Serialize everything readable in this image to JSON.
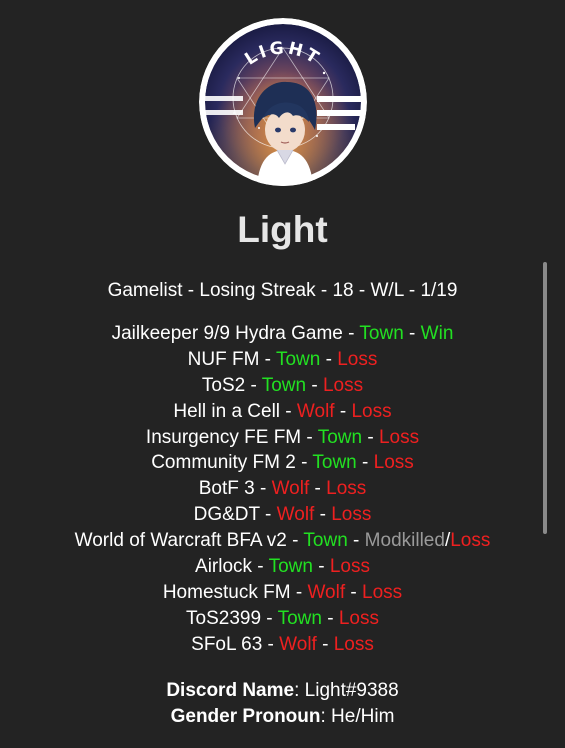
{
  "profile": {
    "name": "Light",
    "avatar_badge": "LIGHT",
    "gamelist_header": "Gamelist - Losing Streak - 18 - W/L - 1/19"
  },
  "colors": {
    "background": "#232323",
    "town": "#22e022",
    "wolf": "#ee2020",
    "loss": "#ee2020",
    "modkilled": "#9a9a9a"
  },
  "games": [
    {
      "parts": [
        {
          "t": "Jailkeeper 9/9 Hydra Game - ",
          "c": "text"
        },
        {
          "t": "Town",
          "c": "town"
        },
        {
          "t": " - ",
          "c": "text"
        },
        {
          "t": "Win",
          "c": "win"
        }
      ]
    },
    {
      "parts": [
        {
          "t": "NUF FM - ",
          "c": "text"
        },
        {
          "t": "Town",
          "c": "town"
        },
        {
          "t": " - ",
          "c": "text"
        },
        {
          "t": "Loss",
          "c": "loss"
        }
      ]
    },
    {
      "parts": [
        {
          "t": "ToS2 - ",
          "c": "text"
        },
        {
          "t": "Town",
          "c": "town"
        },
        {
          "t": " - ",
          "c": "text"
        },
        {
          "t": "Loss",
          "c": "loss"
        }
      ]
    },
    {
      "parts": [
        {
          "t": "Hell in a Cell - ",
          "c": "text"
        },
        {
          "t": "Wolf",
          "c": "wolf"
        },
        {
          "t": " - ",
          "c": "text"
        },
        {
          "t": "Loss",
          "c": "loss"
        }
      ]
    },
    {
      "parts": [
        {
          "t": "Insurgency FE FM - ",
          "c": "text"
        },
        {
          "t": "Town",
          "c": "town"
        },
        {
          "t": " - ",
          "c": "text"
        },
        {
          "t": "Loss",
          "c": "loss"
        }
      ]
    },
    {
      "parts": [
        {
          "t": "Community FM 2 - ",
          "c": "text"
        },
        {
          "t": "Town",
          "c": "town"
        },
        {
          "t": " - ",
          "c": "text"
        },
        {
          "t": "Loss",
          "c": "loss"
        }
      ]
    },
    {
      "parts": [
        {
          "t": "BotF 3 - ",
          "c": "text"
        },
        {
          "t": "Wolf",
          "c": "wolf"
        },
        {
          "t": " - ",
          "c": "text"
        },
        {
          "t": "Loss",
          "c": "loss"
        }
      ]
    },
    {
      "parts": [
        {
          "t": "DG&DT - ",
          "c": "text"
        },
        {
          "t": "Wolf",
          "c": "wolf"
        },
        {
          "t": " - ",
          "c": "text"
        },
        {
          "t": "Loss",
          "c": "loss"
        }
      ]
    },
    {
      "parts": [
        {
          "t": "World of Warcraft BFA v2 - ",
          "c": "text"
        },
        {
          "t": "Town",
          "c": "town"
        },
        {
          "t": " - ",
          "c": "text"
        },
        {
          "t": "Modkilled",
          "c": "mod"
        },
        {
          "t": "/",
          "c": "text"
        },
        {
          "t": "Loss",
          "c": "loss"
        }
      ]
    },
    {
      "parts": [
        {
          "t": "Airlock - ",
          "c": "text"
        },
        {
          "t": "Town",
          "c": "town"
        },
        {
          "t": " - ",
          "c": "text"
        },
        {
          "t": "Loss",
          "c": "loss"
        }
      ]
    },
    {
      "parts": [
        {
          "t": "Homestuck FM - ",
          "c": "text"
        },
        {
          "t": "Wolf",
          "c": "wolf"
        },
        {
          "t": " - ",
          "c": "text"
        },
        {
          "t": "Loss",
          "c": "loss"
        }
      ]
    },
    {
      "parts": [
        {
          "t": "ToS2399 - ",
          "c": "text"
        },
        {
          "t": "Town",
          "c": "town"
        },
        {
          "t": " - ",
          "c": "text"
        },
        {
          "t": "Loss",
          "c": "loss"
        }
      ]
    },
    {
      "parts": [
        {
          "t": "SFoL 63 - ",
          "c": "text"
        },
        {
          "t": "Wolf",
          "c": "wolf"
        },
        {
          "t": " - ",
          "c": "text"
        },
        {
          "t": "Loss",
          "c": "loss"
        }
      ]
    }
  ],
  "info": {
    "discord_label": "Discord Name",
    "discord_value": ": Light#9388",
    "pronoun_label": "Gender Pronoun",
    "pronoun_value": ": He/Him"
  }
}
